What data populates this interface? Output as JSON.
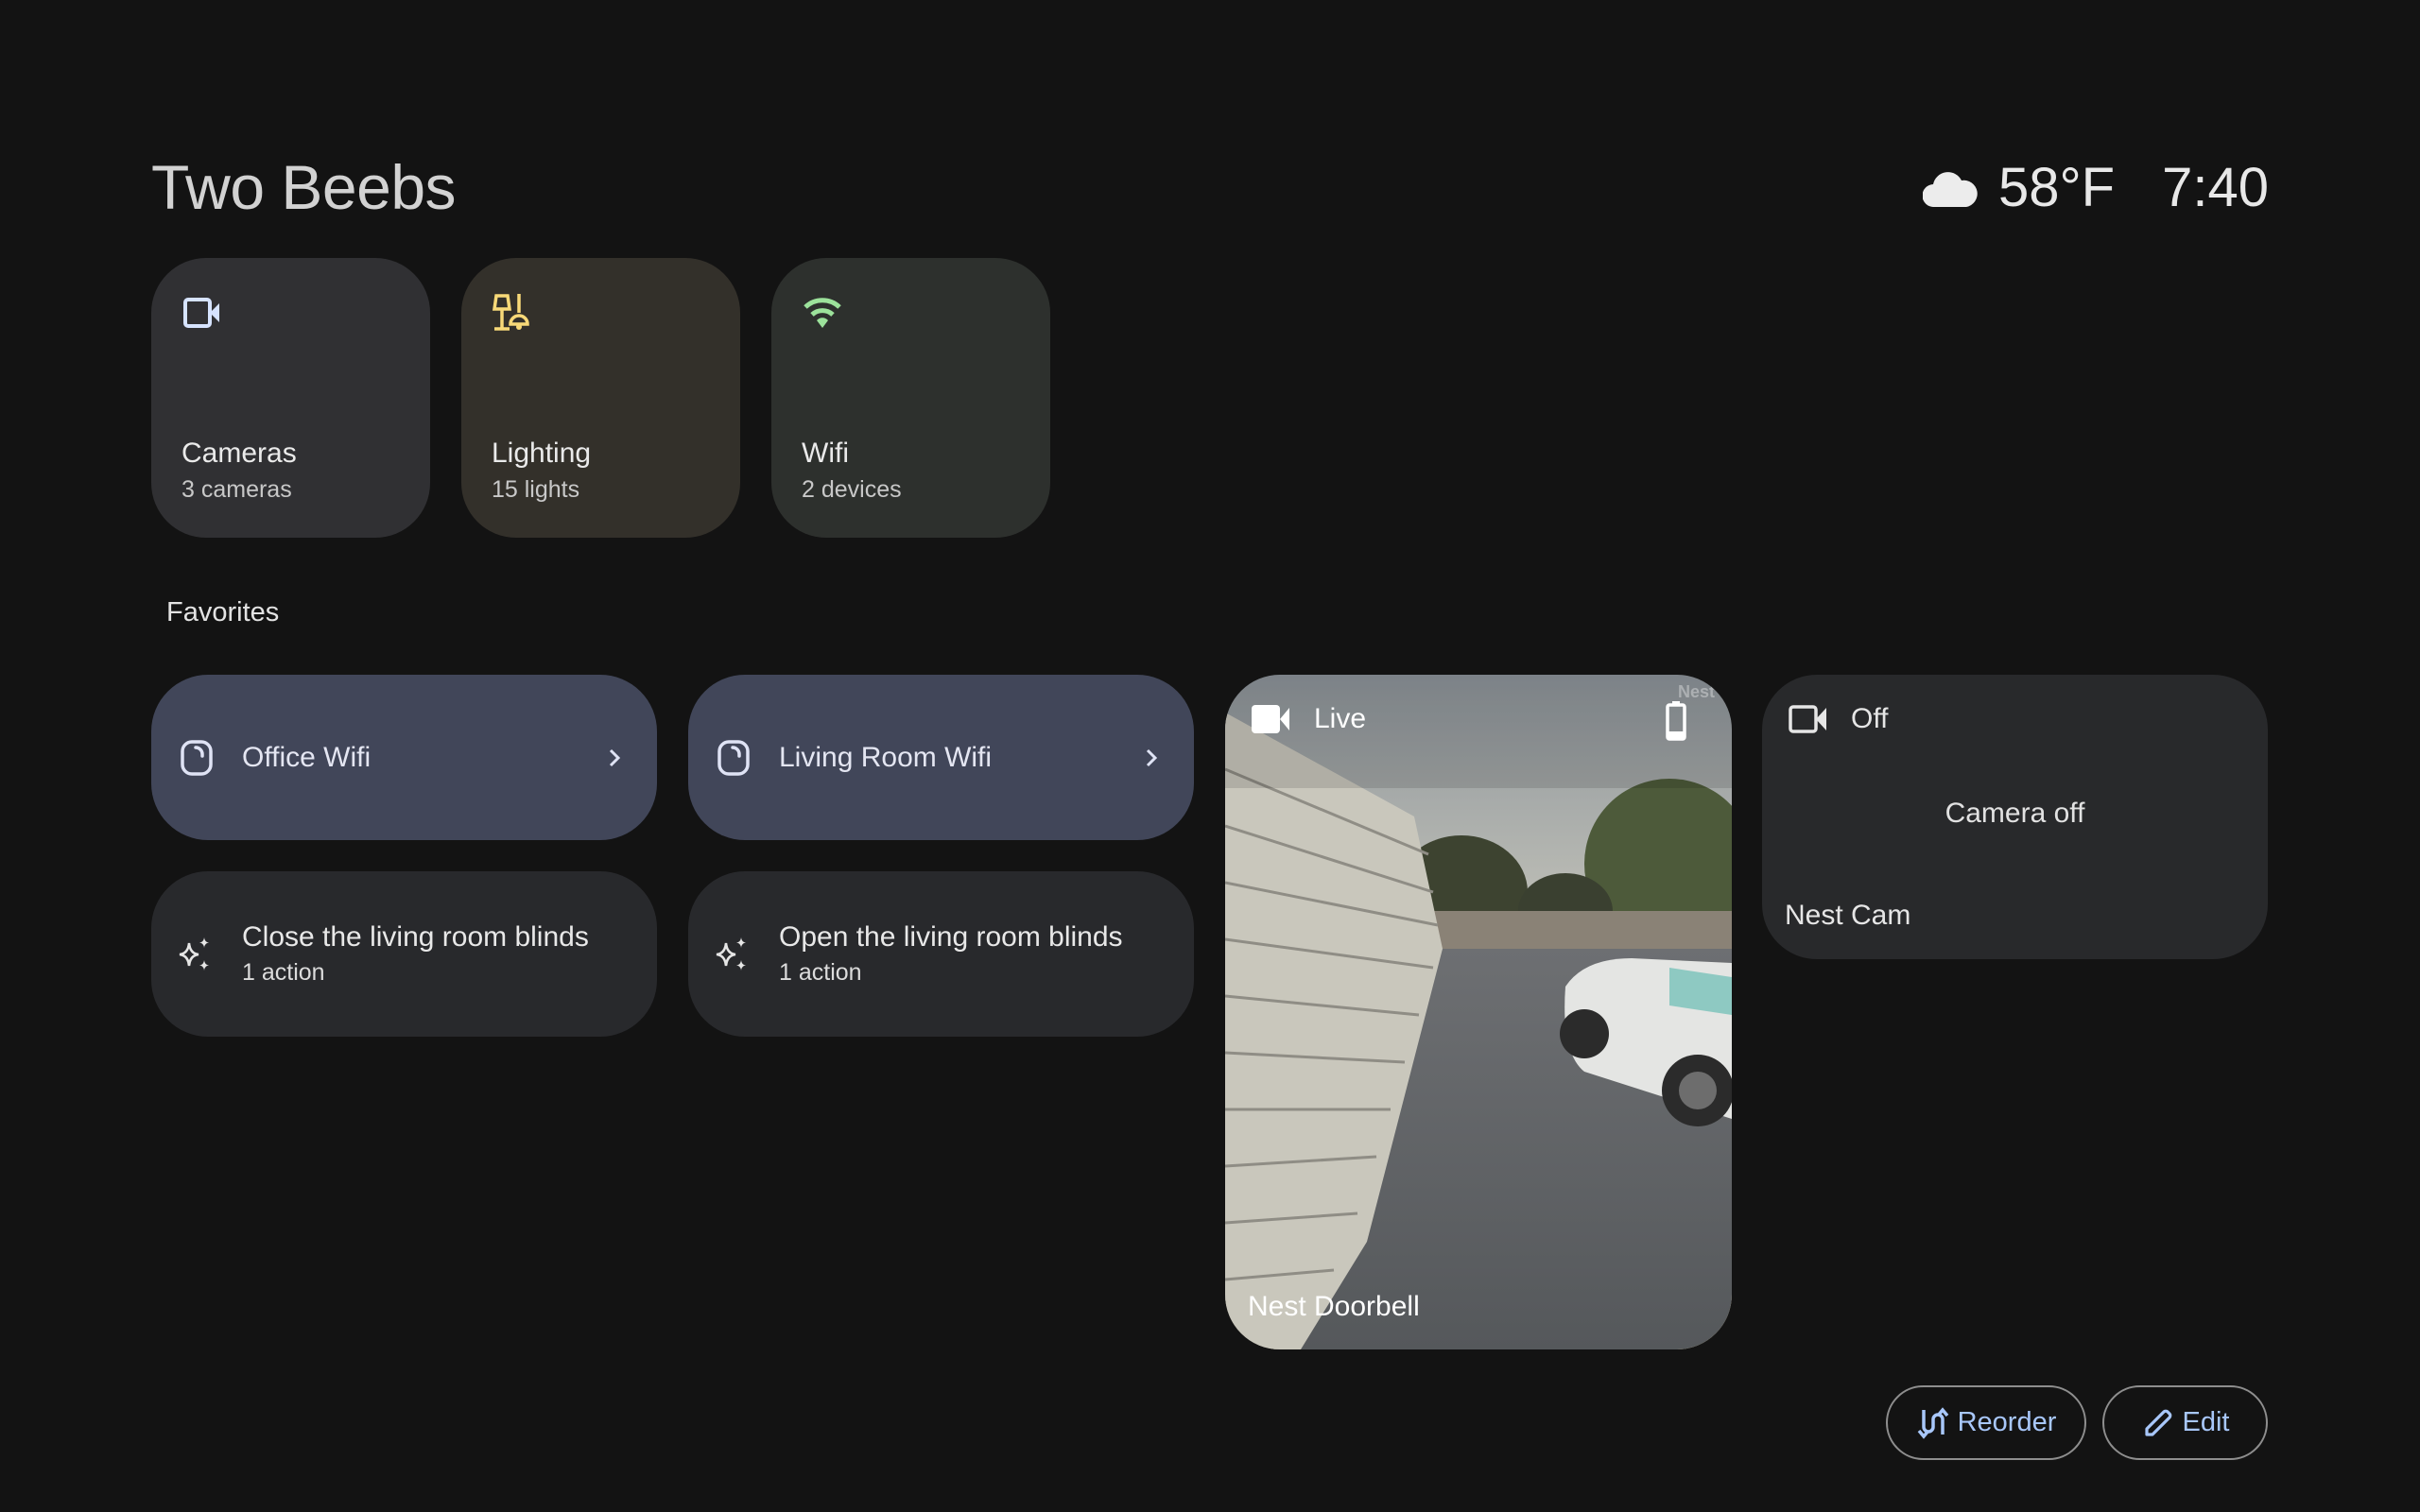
{
  "header": {
    "home_name": "Two Beebs",
    "weather_icon": "cloud-icon",
    "temperature": "58°F",
    "time": "7:40"
  },
  "categories": [
    {
      "name": "Cameras",
      "subtitle": "3 cameras",
      "icon": "video-camera-icon",
      "bg": "#303033",
      "icon_color": "#d6e3ff"
    },
    {
      "name": "Lighting",
      "subtitle": "15 lights",
      "icon": "lamp-icon",
      "bg": "#33302a",
      "icon_color": "#f8d978"
    },
    {
      "name": "Wifi",
      "subtitle": "2 devices",
      "icon": "wifi-icon",
      "bg": "#2d302d",
      "icon_color": "#9ce29b"
    }
  ],
  "favorites": {
    "label": "Favorites",
    "wifi_devices": [
      {
        "name": "Office Wifi",
        "icon": "wifi-router-icon"
      },
      {
        "name": "Living Room Wifi",
        "icon": "wifi-router-icon"
      }
    ],
    "automations": [
      {
        "name": "Close the living room blinds",
        "subtitle": "1 action",
        "icon": "sparkle-icon"
      },
      {
        "name": "Open the living room blinds",
        "subtitle": "1 action",
        "icon": "sparkle-icon"
      }
    ],
    "cameras": [
      {
        "name": "Nest Doorbell",
        "status": "Live",
        "watermark": "Nest",
        "battery_icon": "battery-icon"
      },
      {
        "name": "Nest Cam",
        "status": "Off",
        "message": "Camera off"
      }
    ]
  },
  "actions": {
    "reorder_label": "Reorder",
    "edit_label": "Edit"
  },
  "colors": {
    "background": "#131313",
    "wifi_tile": "#414659",
    "automation_tile": "#28292c",
    "button_accent": "#a8c7fa"
  }
}
